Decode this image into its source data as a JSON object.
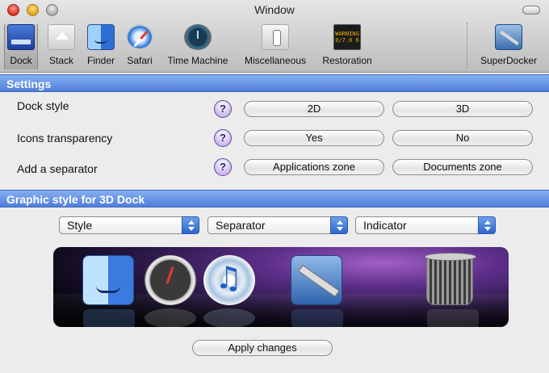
{
  "window": {
    "title": "Window"
  },
  "toolbar": {
    "items": [
      {
        "label": "Dock",
        "icon": "dock-icon",
        "selected": true
      },
      {
        "label": "Stack",
        "icon": "stack-icon"
      },
      {
        "label": "Finder",
        "icon": "finder-icon"
      },
      {
        "label": "Safari",
        "icon": "safari-icon"
      },
      {
        "label": "Time Machine",
        "icon": "time-machine-icon"
      },
      {
        "label": "Miscellaneous",
        "icon": "switch-icon"
      },
      {
        "label": "Restoration",
        "icon": "warning-display-icon",
        "display_text": "WARNING\n0/7.0 6"
      },
      {
        "label": "SuperDocker",
        "icon": "superdocker-icon"
      }
    ]
  },
  "settings": {
    "header": "Settings",
    "rows": [
      {
        "label": "Dock style",
        "help": "?",
        "options": [
          "2D",
          "3D"
        ]
      },
      {
        "label": "Icons transparency",
        "help": "?",
        "options": [
          "Yes",
          "No"
        ]
      },
      {
        "label": "Add a separator",
        "help": "?",
        "options": [
          "Applications zone",
          "Documents zone"
        ]
      }
    ]
  },
  "graphic": {
    "header": "Graphic style for 3D Dock",
    "selects": [
      {
        "value": "Style"
      },
      {
        "value": "Separator"
      },
      {
        "value": "Indicator"
      }
    ],
    "preview_icons": [
      "finder-dock-icon",
      "dashboard-dock-icon",
      "itunes-dock-icon",
      "superdocker-dock-icon",
      "trash-dock-icon"
    ],
    "apply_label": "Apply changes"
  },
  "colors": {
    "section_header": "#5f8ee3",
    "accent": "#3a6fd6",
    "window_bg": "#ececec"
  }
}
